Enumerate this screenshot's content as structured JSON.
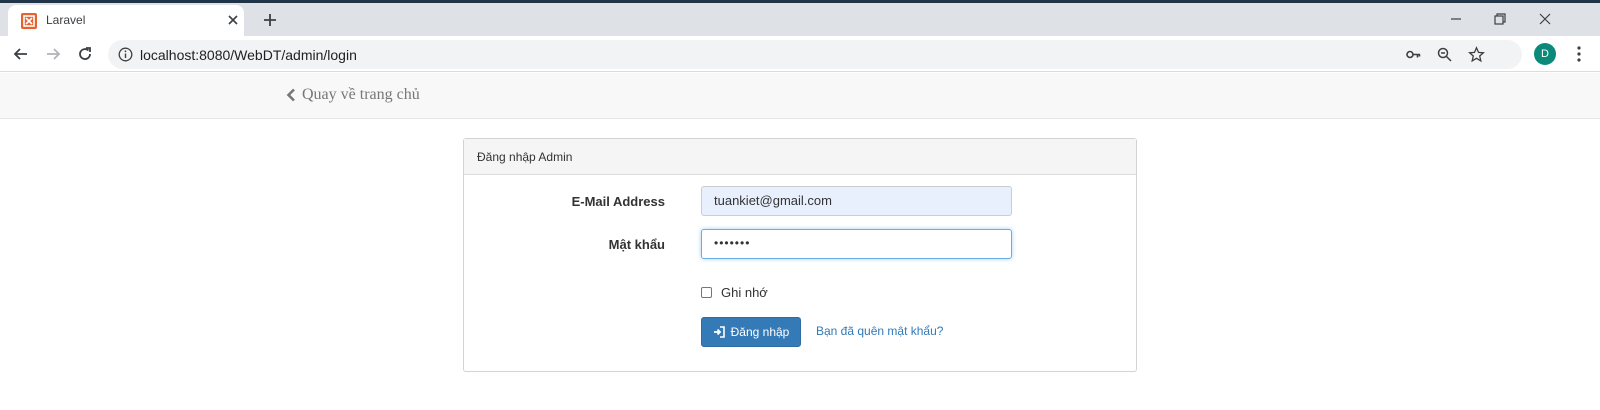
{
  "browser": {
    "tab_title": "Laravel",
    "url": "localhost:8080/WebDT/admin/login",
    "avatar_letter": "D"
  },
  "subnav": {
    "back_label": "Quay về trang chủ"
  },
  "login_panel": {
    "heading": "Đăng nhập Admin",
    "email_label": "E-Mail Address",
    "email_value": "tuankiet@gmail.com",
    "password_label": "Mật khẩu",
    "password_masked": "•••••••",
    "remember_label": "Ghi nhớ",
    "submit_label": "Đăng nhập",
    "forgot_label": "Bạn đã quên mật khẩu?"
  },
  "colors": {
    "primary": "#337ab7",
    "avatar": "#0b8a7c",
    "favicon": "#e8612c"
  }
}
